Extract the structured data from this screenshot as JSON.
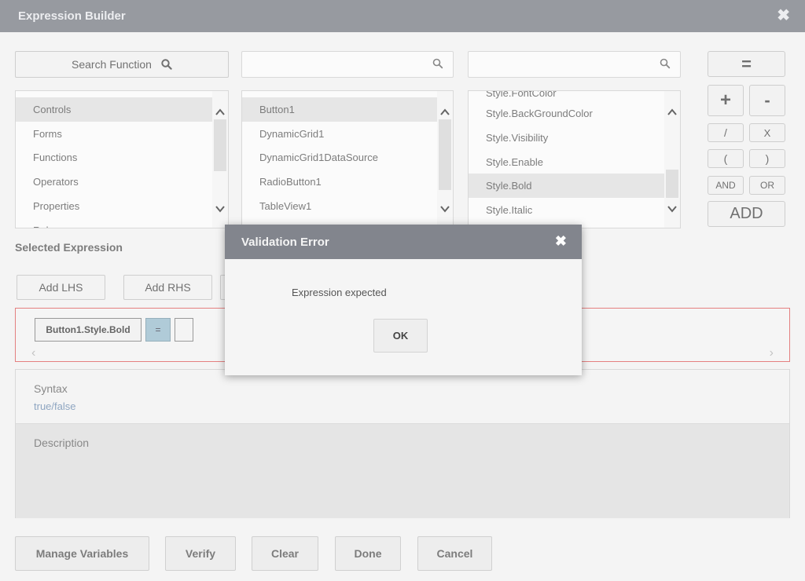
{
  "window": {
    "title": "Expression Builder",
    "close_icon": "close-icon"
  },
  "search": {
    "function_label": "Search Function",
    "box2_placeholder": "",
    "box3_placeholder": ""
  },
  "lists": {
    "categories": {
      "items": [
        "Controls",
        "Forms",
        "Functions",
        "Operators",
        "Properties",
        "Rules"
      ],
      "selected": "Controls"
    },
    "objects": {
      "items": [
        "Button1",
        "DynamicGrid1",
        "DynamicGrid1DataSource",
        "RadioButton1",
        "TableView1"
      ],
      "selected": "Button1"
    },
    "properties": {
      "items": [
        "Style.FontColor",
        "Style.BackGroundColor",
        "Style.Visibility",
        "Style.Enable",
        "Style.Bold",
        "Style.Italic"
      ],
      "selected": "Style.Bold"
    }
  },
  "operators": {
    "equals": "=",
    "plus": "+",
    "minus": "-",
    "divide": "/",
    "multiply": "X",
    "open_paren": "(",
    "close_paren": ")",
    "and": "AND",
    "or": "OR",
    "add": "ADD"
  },
  "selected_expression": {
    "label": "Selected Expression",
    "add_lhs": "Add LHS",
    "add_rhs": "Add RHS",
    "tokens": [
      "Button1.Style.Bold",
      "=",
      ""
    ]
  },
  "syntax": {
    "label": "Syntax",
    "value": "true/false"
  },
  "description": {
    "label": "Description",
    "value": ""
  },
  "footer": {
    "manage_variables": "Manage Variables",
    "verify": "Verify",
    "clear": "Clear",
    "done": "Done",
    "cancel": "Cancel"
  },
  "dialog": {
    "title": "Validation Error",
    "message": "Expression expected",
    "ok": "OK"
  },
  "colors": {
    "titlebar": "#6b6f77",
    "dialog_header": "#82858d",
    "error_border": "#d94a4a",
    "operator_token": "#8fb5c7",
    "syntax_value": "#5d7fa6"
  }
}
